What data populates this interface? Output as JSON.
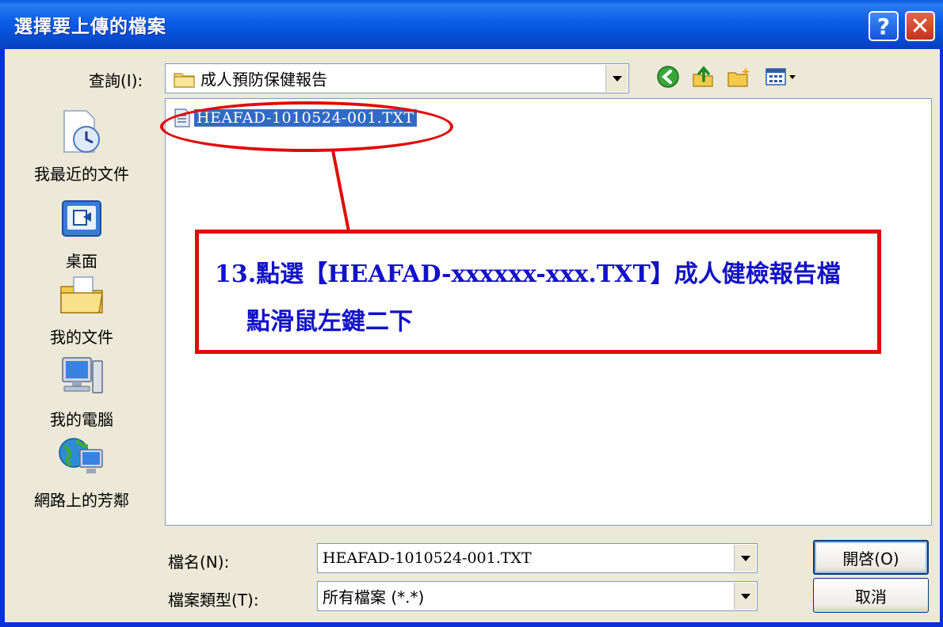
{
  "window": {
    "title": "選擇要上傳的檔案",
    "help_label": "?",
    "close_label": "✕"
  },
  "lookin": {
    "label": "查詢(I):",
    "value": "成人預防保健報告",
    "icons": [
      "folder-icon",
      "back-icon",
      "up-folder-icon",
      "new-folder-icon",
      "view-menu-icon"
    ]
  },
  "places": [
    {
      "label": "我最近的文件",
      "icon": "recent-documents-icon"
    },
    {
      "label": "桌面",
      "icon": "desktop-icon"
    },
    {
      "label": "我的文件",
      "icon": "my-documents-icon"
    },
    {
      "label": "我的電腦",
      "icon": "my-computer-icon"
    },
    {
      "label": "網路上的芳鄰",
      "icon": "network-places-icon"
    }
  ],
  "files": [
    {
      "name": "HEAFAD-1010524-001.TXT",
      "icon": "text-file-icon",
      "selected": true
    }
  ],
  "annotation": {
    "line1": "13.點選【HEAFAD-xxxxxx-xxx.TXT】成人健檢報告檔",
    "line2": "點滑鼠左鍵二下",
    "color": "#e20b0b",
    "text_color": "#1212c8"
  },
  "filename": {
    "label": "檔名(N):",
    "value": "HEAFAD-1010524-001.TXT"
  },
  "filetype": {
    "label": "檔案類型(T):",
    "value": "所有檔案 (*.*)"
  },
  "buttons": {
    "open": "開啓(O)",
    "cancel": "取消"
  }
}
